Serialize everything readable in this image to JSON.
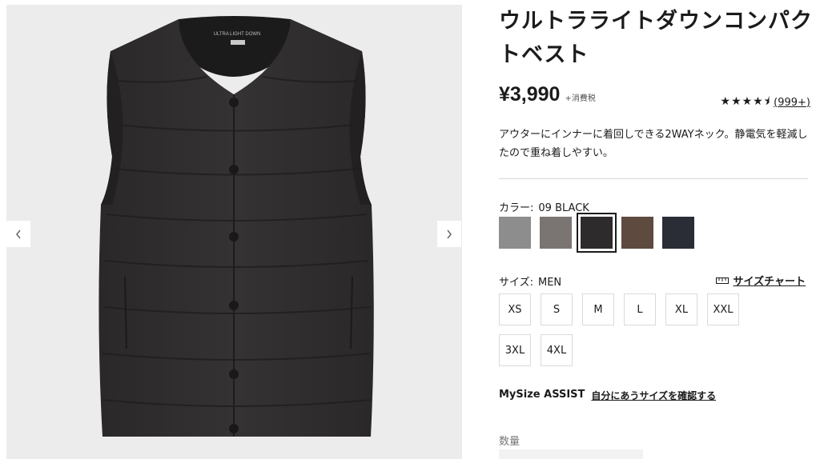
{
  "product": {
    "title": "ウルトラライトダウンコンパクトベスト",
    "price": "¥3,990",
    "tax_note": "+消費税",
    "rating_stars": "★★★★⯨",
    "review_count": "(999+)",
    "description": "アウターにインナーに着回しできる2WAYネック。静電気を軽減したので重ね着しやすい。",
    "image_label": "ULTRA LIGHT DOWN"
  },
  "color": {
    "label": "カラー:",
    "value": "09 BLACK",
    "swatches": [
      {
        "name": "gray",
        "hex": "#8d8d8d"
      },
      {
        "name": "dark-gray",
        "hex": "#7a7572"
      },
      {
        "name": "black",
        "hex": "#2e2b2c"
      },
      {
        "name": "brown",
        "hex": "#5e4a3f"
      },
      {
        "name": "navy",
        "hex": "#2a2c36"
      }
    ]
  },
  "size": {
    "label": "サイズ:",
    "value": "MEN",
    "chart_link": "サイズチャート",
    "options": [
      "XS",
      "S",
      "M",
      "L",
      "XL",
      "XXL",
      "3XL",
      "4XL"
    ]
  },
  "mysize": {
    "label": "MySize ASSIST",
    "link": "自分にあうサイズを確認する"
  },
  "quantity": {
    "label": "数量"
  },
  "gallery": {
    "prev_icon": "chevron-left-icon",
    "next_icon": "chevron-right-icon"
  }
}
